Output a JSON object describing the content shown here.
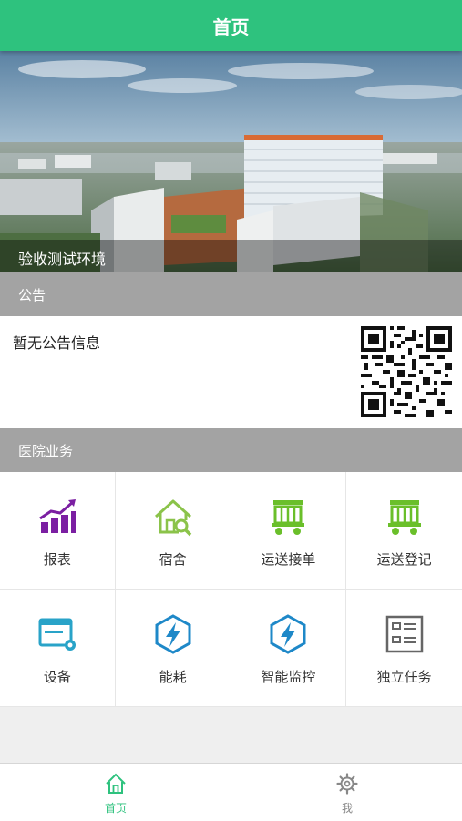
{
  "header": {
    "title": "首页"
  },
  "banner": {
    "caption": "验收测试环境"
  },
  "notice": {
    "section_title": "公告",
    "text": "暂无公告信息"
  },
  "services": {
    "section_title": "医院业务",
    "items": [
      {
        "label": "报表",
        "icon": "bar-chart-icon",
        "color": "#7b1fa2"
      },
      {
        "label": "宿舍",
        "icon": "house-wrench-icon",
        "color": "#8bc34a"
      },
      {
        "label": "运送接单",
        "icon": "cart-icon",
        "color": "#6abf2a"
      },
      {
        "label": "运送登记",
        "icon": "cart-icon",
        "color": "#6abf2a"
      },
      {
        "label": "设备",
        "icon": "device-window-icon",
        "color": "#29a3c8"
      },
      {
        "label": "能耗",
        "icon": "energy-bolt-icon",
        "color": "#1e88c8"
      },
      {
        "label": "智能监控",
        "icon": "energy-bolt-icon",
        "color": "#1e88c8"
      },
      {
        "label": "独立任务",
        "icon": "task-list-icon",
        "color": "#666666"
      }
    ]
  },
  "tabbar": {
    "tabs": [
      {
        "label": "首页",
        "icon": "home-icon",
        "active": true,
        "color": "#2ec27e"
      },
      {
        "label": "我",
        "icon": "gear-icon",
        "active": false,
        "color": "#888888"
      }
    ]
  }
}
